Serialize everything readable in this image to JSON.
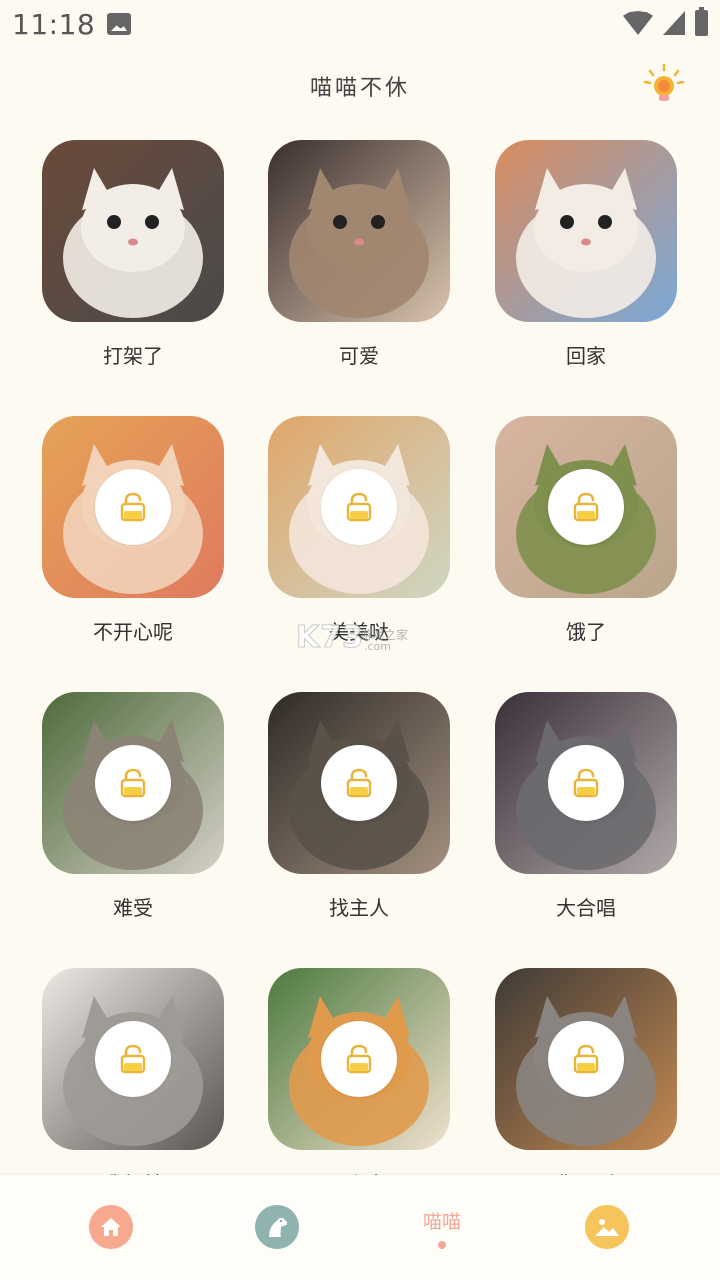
{
  "status_bar": {
    "time": "11:18"
  },
  "header": {
    "title": "喵喵不休"
  },
  "cards": [
    {
      "label": "打架了",
      "locked": false,
      "palette": [
        "#6b4a3b",
        "#f2ede6",
        "#4a4a4a"
      ]
    },
    {
      "label": "可爱",
      "locked": false,
      "palette": [
        "#3a2e2d",
        "#a18670",
        "#d9c4ae"
      ]
    },
    {
      "label": "回家",
      "locked": false,
      "palette": [
        "#d98b5e",
        "#f3ece5",
        "#7aa9d9"
      ]
    },
    {
      "label": "不开心呢",
      "locked": true,
      "palette": [
        "#e5a356",
        "#f2d2b8",
        "#e07a5f"
      ]
    },
    {
      "label": "美美哒",
      "locked": true,
      "palette": [
        "#e0a66a",
        "#f3e6da",
        "#cfd6c4"
      ]
    },
    {
      "label": "饿了",
      "locked": true,
      "palette": [
        "#d8b5a1",
        "#7f8f4e",
        "#b9a58c"
      ]
    },
    {
      "label": "难受",
      "locked": true,
      "palette": [
        "#4d6b3a",
        "#8b8376",
        "#d5d0c8"
      ]
    },
    {
      "label": "找主人",
      "locked": true,
      "palette": [
        "#2f2a27",
        "#5a5148",
        "#a39180"
      ]
    },
    {
      "label": "大合唱",
      "locked": true,
      "palette": [
        "#3b2f3a",
        "#6c6a6e",
        "#b0a9a8"
      ]
    },
    {
      "label": "我很美",
      "locked": true,
      "palette": [
        "#ece8e4",
        "#9e9a96",
        "#585552"
      ]
    },
    {
      "label": "呼叫",
      "locked": true,
      "palette": [
        "#4c7a3e",
        "#e09a4c",
        "#f2e1cf"
      ]
    },
    {
      "label": "你不睡",
      "locked": true,
      "palette": [
        "#3f3a36",
        "#8a8480",
        "#c48a52"
      ]
    }
  ],
  "bottom_nav": {
    "items": [
      {
        "name": "home-icon",
        "color": "#f6a98f"
      },
      {
        "name": "dog-icon",
        "color": "#8fb3ae"
      },
      {
        "name": "cat-tab",
        "label": "喵喵",
        "color": "#f1a99b"
      },
      {
        "name": "gallery-icon",
        "color": "#f5c45a"
      }
    ]
  }
}
